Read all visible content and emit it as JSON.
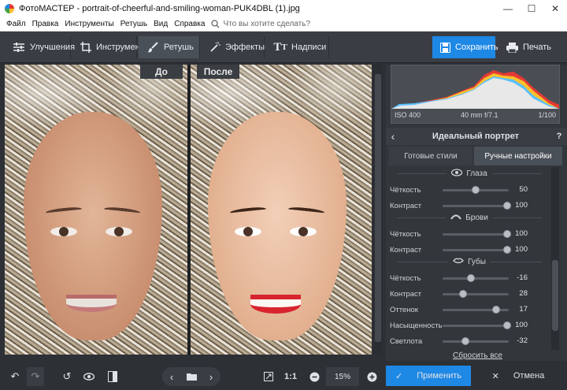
{
  "window": {
    "title": "ФотоМАСТЕР - portrait-of-cheerful-and-smiling-woman-PUK4DBL (1).jpg",
    "minimize": "—",
    "maximize": "☐",
    "close": "✕"
  },
  "menu": {
    "items": [
      "Файл",
      "Правка",
      "Инструменты",
      "Ретушь",
      "Вид",
      "Справка"
    ],
    "search_placeholder": "Что вы хотите сделать?"
  },
  "tabs": [
    {
      "label": "Улучшения",
      "icon": "sliders-icon"
    },
    {
      "label": "Инструменты",
      "icon": "crop-icon"
    },
    {
      "label": "Ретушь",
      "icon": "brush-icon"
    },
    {
      "label": "Эффекты",
      "icon": "magic-wand-icon"
    },
    {
      "label": "Надписи",
      "icon": "text-icon"
    }
  ],
  "toolbar": {
    "save_label": "Сохранить",
    "print_label": "Печать"
  },
  "compare": {
    "before": "До",
    "after": "После"
  },
  "histogram": {
    "iso": "ISO 400",
    "lens": "40 mm f/7.1",
    "shutter": "1/100"
  },
  "panel": {
    "title": "Идеальный портрет",
    "help": "?",
    "tabs": [
      "Готовые стили",
      "Ручные настройки"
    ],
    "reset": "Сбросить все"
  },
  "sections": [
    {
      "title": "Глаза",
      "icon": "eye-icon",
      "rows": [
        {
          "label": "Чёткость",
          "value": "50",
          "level": 0.5
        },
        {
          "label": "Контраст",
          "value": "100",
          "level": 1.0
        }
      ]
    },
    {
      "title": "Брови",
      "icon": "brow-icon",
      "rows": [
        {
          "label": "Чёткость",
          "value": "100",
          "level": 1.0
        },
        {
          "label": "Контраст",
          "value": "100",
          "level": 1.0
        }
      ]
    },
    {
      "title": "Губы",
      "icon": "lips-icon",
      "rows": [
        {
          "label": "Чёткость",
          "value": "-16",
          "level": 0.42
        },
        {
          "label": "Контраст",
          "value": "28",
          "level": 0.3
        },
        {
          "label": "Оттенок",
          "value": "17",
          "level": 0.83
        },
        {
          "label": "Насыщенность",
          "value": "100",
          "level": 1.0
        },
        {
          "label": "Светлота",
          "value": "-32",
          "level": 0.34
        }
      ]
    }
  ],
  "bottom": {
    "zoom": "15%",
    "ratio": "1:1",
    "apply": "Применить",
    "cancel": "Отмена"
  },
  "colors": {
    "accent": "#1e88e5",
    "panel": "#33373c",
    "toolbar": "#3a3e44",
    "lips": "#d8242f"
  }
}
